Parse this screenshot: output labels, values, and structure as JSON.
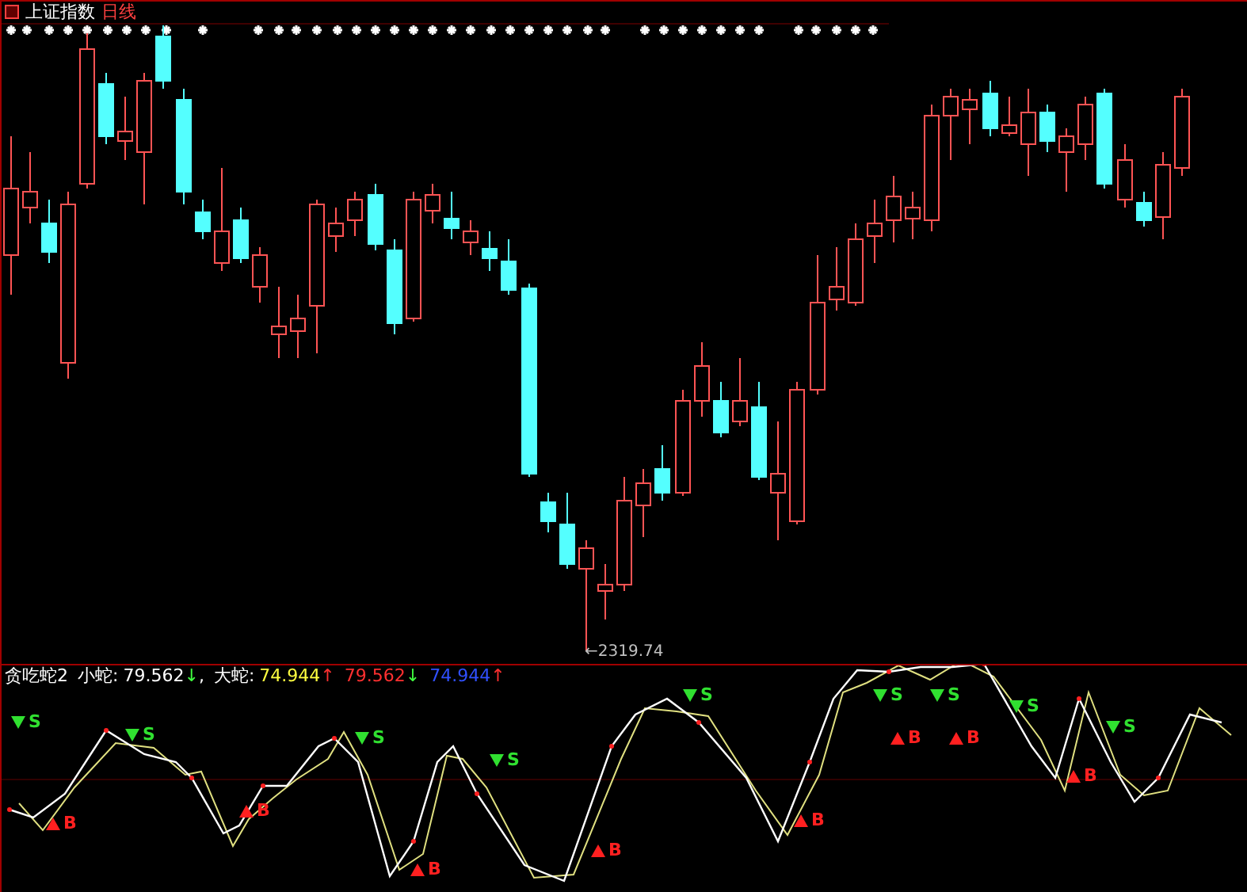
{
  "price_panel": {
    "title": "上证指数",
    "period": "日线",
    "low_label": "←2319.74"
  },
  "indicator": {
    "name": "贪吃蛇2",
    "readings": [
      {
        "label": "小蛇:",
        "value": "79.562",
        "arrow": {
          "symbol": "↓",
          "color": "#40ff40"
        },
        "separator": ",",
        "color": "#ffffff"
      },
      {
        "label": "大蛇:",
        "value": "74.944",
        "arrow": {
          "symbol": "↑",
          "color": "#ff3030"
        },
        "color": "#ffff40"
      },
      {
        "value": "79.562",
        "arrow": {
          "symbol": "↓",
          "color": "#40ff40"
        },
        "color": "#ff3030"
      },
      {
        "value": "74.944",
        "arrow": {
          "symbol": "↑",
          "color": "#ff3030"
        },
        "color": "#3050ff"
      }
    ],
    "signals": [
      {
        "kind": "sell",
        "label": "S"
      },
      {
        "kind": "buy",
        "label": "B"
      },
      {
        "kind": "sell",
        "label": "S"
      },
      {
        "kind": "buy",
        "label": "B"
      },
      {
        "kind": "sell",
        "label": "S"
      },
      {
        "kind": "buy",
        "label": "B"
      },
      {
        "kind": "sell",
        "label": "S"
      },
      {
        "kind": "buy",
        "label": "B"
      },
      {
        "kind": "sell",
        "label": "S"
      },
      {
        "kind": "buy",
        "label": "B"
      },
      {
        "kind": "sell",
        "label": "S"
      },
      {
        "kind": "buy",
        "label": "B"
      },
      {
        "kind": "sell",
        "label": "S"
      },
      {
        "kind": "buy",
        "label": "B"
      },
      {
        "kind": "sell",
        "label": "S"
      },
      {
        "kind": "buy",
        "label": "B"
      },
      {
        "kind": "sell",
        "label": "S"
      }
    ]
  }
}
